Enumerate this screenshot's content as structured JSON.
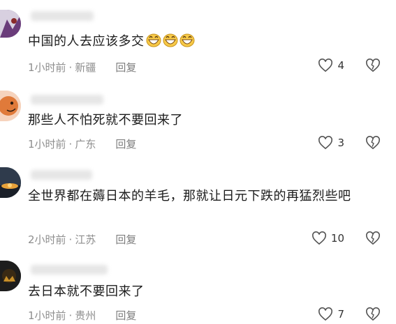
{
  "comments": [
    {
      "text": "中国的人去应该多交",
      "emoji_count": 3,
      "emoji": "grinning-face-emoji",
      "time": "1小时前",
      "location": "新疆",
      "reply": "回复",
      "likes": "4",
      "avatar_color": "#6a5a8a"
    },
    {
      "text": "那些人不怕死就不要回来了",
      "time": "1小时前",
      "location": "广东",
      "reply": "回复",
      "likes": "3",
      "avatar_color": "#e07a3a"
    },
    {
      "text": "全世界都在薅日本的羊毛，那就让日元下跌的再猛烈些吧",
      "time": "2小时前",
      "location": "江苏",
      "reply": "回复",
      "likes": "10",
      "avatar_color": "#2f3b4c"
    },
    {
      "text": "去日本就不要回来了",
      "time": "1小时前",
      "location": "贵州",
      "reply": "回复",
      "likes": "7",
      "avatar_color": "#1d1d1d"
    }
  ],
  "icons": {
    "like": "heart-outline-icon",
    "dislike": "broken-heart-icon"
  },
  "colors": {
    "meta": "#8e8e8e",
    "text": "#1b1b1b"
  }
}
